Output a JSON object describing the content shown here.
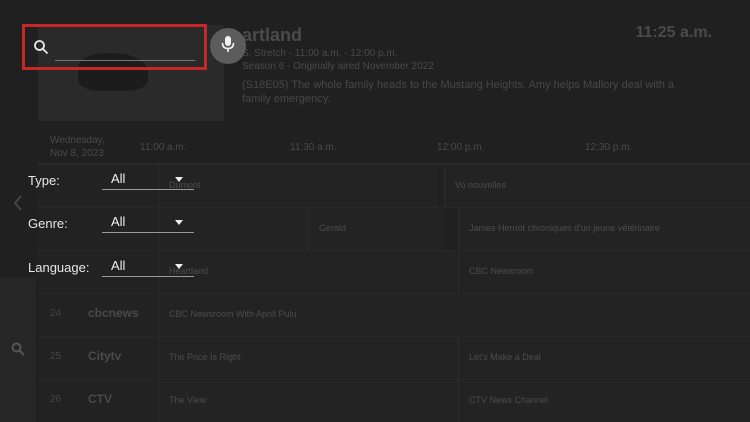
{
  "search": {
    "placeholder": "",
    "value": ""
  },
  "filters": [
    {
      "label": "Type:",
      "value": "All"
    },
    {
      "label": "Genre:",
      "value": "All"
    },
    {
      "label": "Language:",
      "value": "All"
    }
  ],
  "background_guide": {
    "show_title": "artland",
    "clock": "11:25 a.m.",
    "meta_line1": "S. Stretch - 11:00 a.m. - 12:00 p.m.",
    "meta_line2": "Season 6 - Originally aired November 2022",
    "description_line1": "(S18E05) The whole family heads to the Mustang Heights. Amy helps Mallory deal with a",
    "description_line2": "family emergency.",
    "date_line1": "Wednesday,",
    "date_line2": "Nov 8, 2023",
    "time_slots": [
      "11:00 a.m.",
      "11:30 a.m.",
      "12:00 p.m.",
      "12:30 p.m."
    ],
    "rows": [
      {
        "num": "",
        "logo": "",
        "programs": [
          "Dumont",
          "Vo nouvelles"
        ]
      },
      {
        "num": "",
        "logo": "",
        "programs": [
          "",
          "Gerald",
          "James Herriot chroniques d'un jeune vétérinaire"
        ]
      },
      {
        "num": "",
        "logo": "",
        "programs": [
          "Heartland",
          "CBC Newsroom"
        ]
      },
      {
        "num": "24",
        "logo": "cbcnews",
        "programs": [
          "CBC Newsroom With Aprill Pulu"
        ]
      },
      {
        "num": "25",
        "logo": "Citytv",
        "programs": [
          "The Price Is Right",
          "Let's Make a Deal"
        ]
      },
      {
        "num": "26",
        "logo": "CTV",
        "programs": [
          "The View",
          "CTV News Channel"
        ]
      }
    ]
  },
  "colors": {
    "focus_border": "#c62828",
    "mic_button_bg": "#5c5c5c",
    "background": "#1b1b1b"
  },
  "icons": {
    "search": "search-icon",
    "mic": "microphone-icon",
    "caret": "caret-down-icon",
    "back": "chevron-left-icon"
  }
}
